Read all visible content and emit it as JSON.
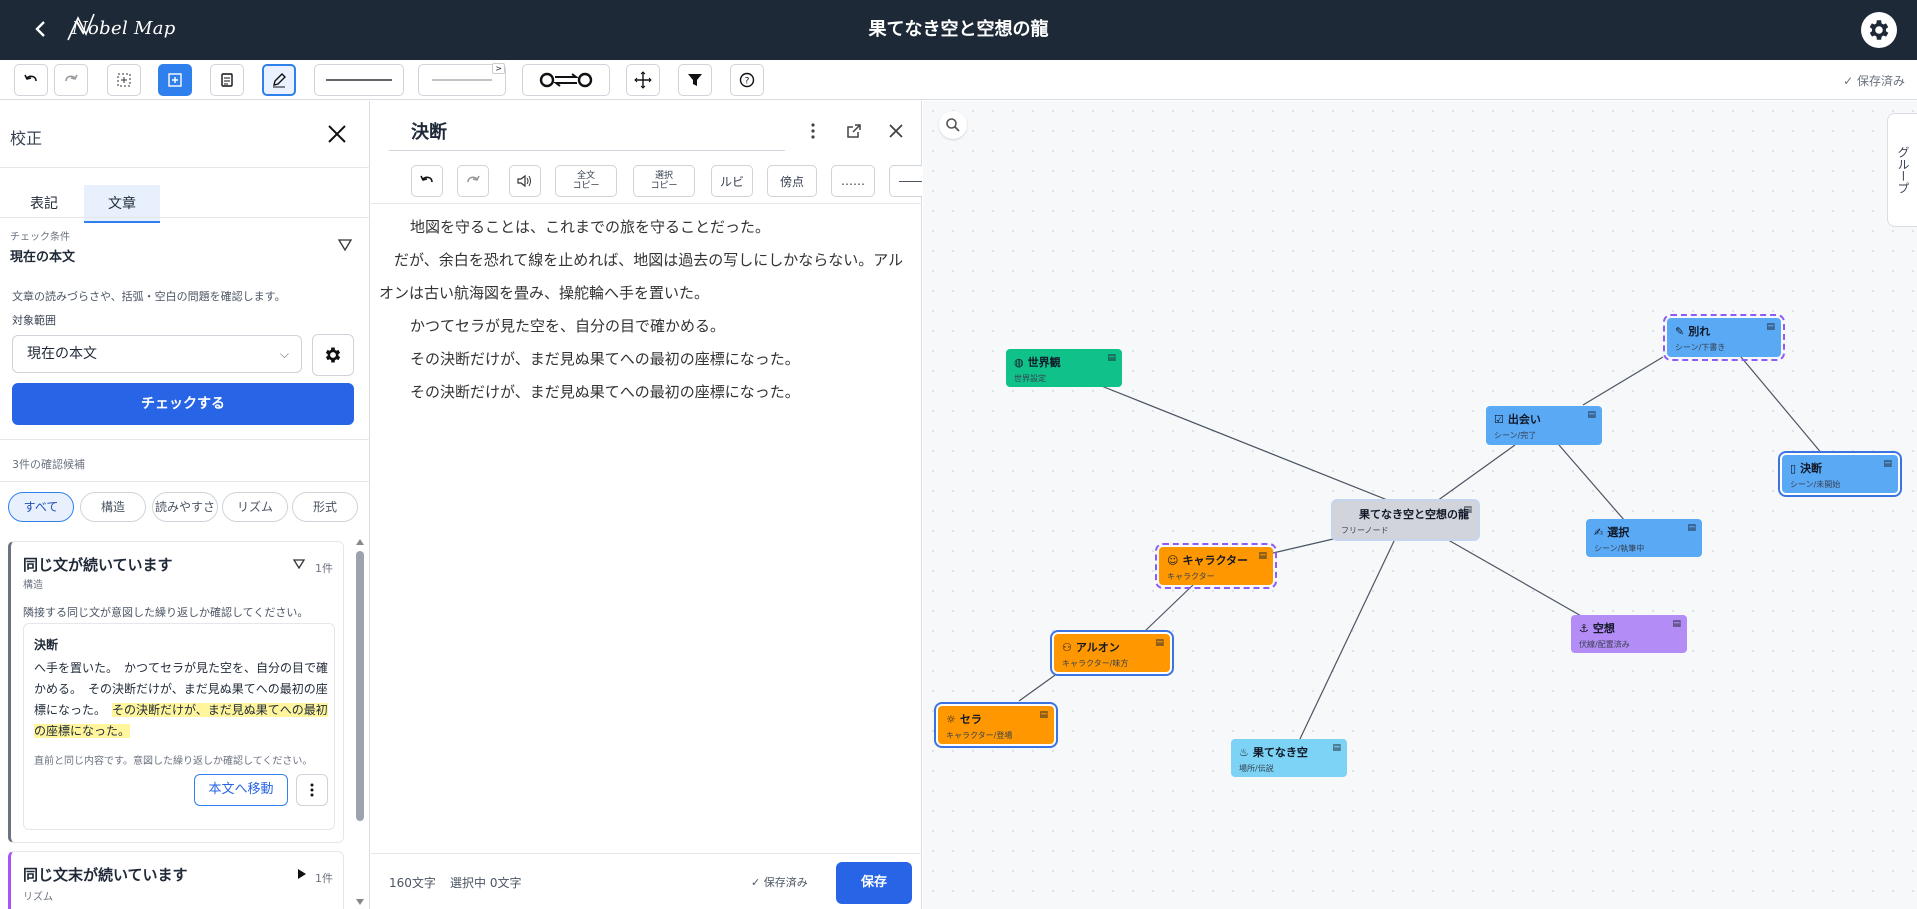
{
  "app": {
    "logo_text": "Nobel Map",
    "doc_title": "果てなき空と空想の龍",
    "saved_status": "保存済み"
  },
  "toolbar": {
    "buttons": [
      {
        "icon": "undo-icon"
      },
      {
        "icon": "redo-icon"
      },
      {
        "icon": "grid-snap-icon"
      },
      {
        "icon": "add-node-icon"
      },
      {
        "icon": "document-icon"
      },
      {
        "icon": "pen-icon"
      },
      {
        "icon": "line-style-solid-icon"
      },
      {
        "icon": "line-style-thin-icon"
      },
      {
        "icon": "bidirectional-link-icon"
      },
      {
        "icon": "move-cross-icon"
      },
      {
        "icon": "filter-icon"
      },
      {
        "icon": "help-icon"
      }
    ]
  },
  "proofread": {
    "title": "校正",
    "tabs": [
      "表記",
      "文章"
    ],
    "selected_tab": "文章",
    "condition_label": "チェック条件",
    "condition_value": "現在の本文",
    "description": "文章の読みづらさや、括弧・空白の問題を確認します。",
    "range_label": "対象範囲",
    "range_value": "現在の本文",
    "check_button": "チェックする",
    "count_label": "3件の確認候補",
    "chips": [
      "すべて",
      "構造",
      "読みやすさ",
      "リズム",
      "形式"
    ],
    "issues": [
      {
        "title": "同じ文が続いています",
        "category": "構造",
        "count": "1件",
        "description": "隣接する同じ文が意図した繰り返しか確認してください。",
        "excerpt_title": "決断",
        "excerpt_plain": "へ手を置いた。　かつてセラが見た空を、自分の目で確かめる。　その決断だけが、まだ見ぬ果てへの最初の座標になった。　",
        "excerpt_highlight": "その決断だけが、まだ見ぬ果てへの最初の座標になった。",
        "note": "直前と同じ内容です。意図した繰り返しか確認してください。",
        "goto_button": "本文へ移動"
      },
      {
        "title": "同じ文末が続いています",
        "category": "リズム",
        "count": "1件"
      }
    ]
  },
  "editor": {
    "title": "決断",
    "tools": [
      "全文\nコピー",
      "選択\nコピー",
      "ルビ",
      "傍点",
      "……",
      "――"
    ],
    "paragraphs": [
      "地図を守ることは、これまでの旅を守ることだった。",
      "だが、余白を恐れて線を止めれば、地図は過去の写しにしかならない。アルオンは古い航海図を畳み、操舵輪へ手を置いた。",
      "かつてセラが見た空を、自分の目で確かめる。",
      "その決断だけが、まだ見ぬ果てへの最初の座標になった。",
      "その決断だけが、まだ見ぬ果てへの最初の座標になった。"
    ],
    "char_count": "160文字",
    "selected_count": "選択中 0文字",
    "saved_status": "保存済み",
    "save_button": "保存"
  },
  "map": {
    "group_tab": "グループ",
    "nodes": [
      {
        "id": "center",
        "title": "果てなき空と空想の龍",
        "sub": "フリーノード",
        "color": "#d1d5db"
      },
      {
        "id": "world",
        "title": "世界観",
        "sub": "世界設定",
        "color": "#10c28a",
        "icon": "globe-icon"
      },
      {
        "id": "meet",
        "title": "出会い",
        "sub": "シーン/完了",
        "color": "#5aa9f5",
        "icon": "check-doc-icon"
      },
      {
        "id": "parting",
        "title": "別れ",
        "sub": "シーン/下書き",
        "color": "#5aa9f5",
        "icon": "draft-doc-icon"
      },
      {
        "id": "decision",
        "title": "決断",
        "sub": "シーン/未開始",
        "color": "#5aa9f5",
        "icon": "blank-doc-icon"
      },
      {
        "id": "choice",
        "title": "選択",
        "sub": "シーン/執筆中",
        "color": "#5aa9f5",
        "icon": "writing-icon"
      },
      {
        "id": "character",
        "title": "キャラクター",
        "sub": "キャラクター",
        "color": "#ff9800",
        "icon": "person-icon"
      },
      {
        "id": "alon",
        "title": "アルオン",
        "sub": "キャラクター/味方",
        "color": "#ff9800",
        "icon": "people-icon"
      },
      {
        "id": "sera",
        "title": "セラ",
        "sub": "キャラクター/登場",
        "color": "#ff9800",
        "icon": "sun-person-icon"
      },
      {
        "id": "fantasy",
        "title": "空想",
        "sub": "伏線/配置済み",
        "color": "#b38cf5",
        "icon": "anchor-icon"
      },
      {
        "id": "sky",
        "title": "果てなき空",
        "sub": "場所/伝説",
        "color": "#7dd3f5",
        "icon": "fire-icon"
      }
    ]
  }
}
